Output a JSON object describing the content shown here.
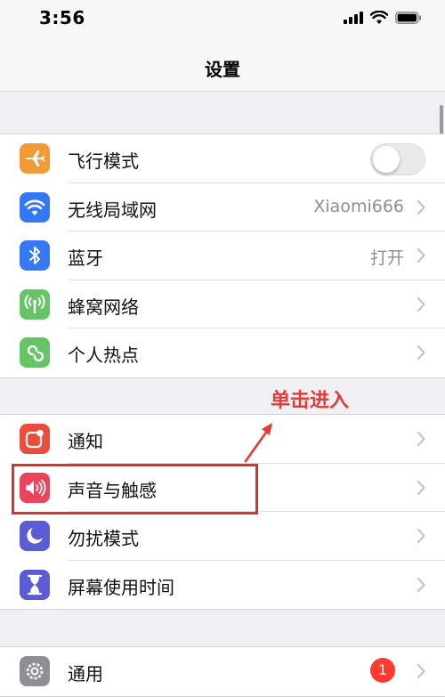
{
  "status_bar": {
    "time": "3:56"
  },
  "nav": {
    "title": "设置"
  },
  "groups": {
    "connectivity": [
      {
        "label": "飞行模式",
        "icon": "airplane-icon",
        "icon_color": "#f19a38",
        "toggle_on": false
      },
      {
        "label": "无线局域网",
        "icon": "wifi-icon",
        "icon_color": "#3478f6",
        "value": "Xiaomi666"
      },
      {
        "label": "蓝牙",
        "icon": "bluetooth-icon",
        "icon_color": "#3478f6",
        "value": "打开"
      },
      {
        "label": "蜂窝网络",
        "icon": "cellular-icon",
        "icon_color": "#65c466"
      },
      {
        "label": "个人热点",
        "icon": "hotspot-icon",
        "icon_color": "#65c466"
      }
    ],
    "notifications": [
      {
        "label": "通知",
        "icon": "notifications-icon",
        "icon_color": "#eb4d3d"
      },
      {
        "label": "声音与触感",
        "icon": "speaker-icon",
        "icon_color": "#e9435d"
      },
      {
        "label": "勿扰模式",
        "icon": "moon-icon",
        "icon_color": "#5b5bd6"
      },
      {
        "label": "屏幕使用时间",
        "icon": "hourglass-icon",
        "icon_color": "#5b5bd6"
      }
    ],
    "general": [
      {
        "label": "通用",
        "icon": "gear-icon",
        "icon_color": "#8e8e93",
        "badge": "1"
      }
    ]
  },
  "annotation": {
    "text": "单击进入",
    "color": "#e53935"
  }
}
